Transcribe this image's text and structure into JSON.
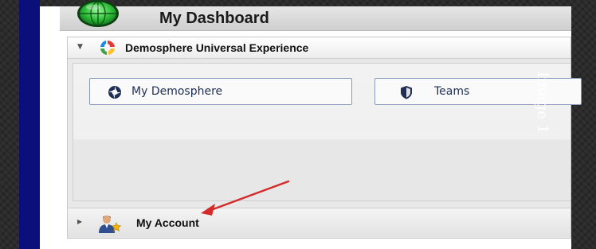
{
  "dashboard": {
    "title": "My Dashboard",
    "logo_icon": "green-globe-icon"
  },
  "section": {
    "title": "Demosphere Universal Experience",
    "toggle_icon": "caret-down-icon",
    "icon": "demosphere-logo-icon",
    "tiles": [
      {
        "label": "My Demosphere",
        "icon": "demosphere-logo-icon"
      },
      {
        "label": "Teams",
        "icon": "shield-icon"
      }
    ]
  },
  "account": {
    "label": "My Account",
    "toggle_icon": "caret-right-icon",
    "icon": "user-star-icon"
  },
  "annotation": {
    "caption": "Image 1",
    "arrow_color": "#d42a2a"
  },
  "colors": {
    "sidebar": "#0a0f7a",
    "tile_border": "#8a9ab8",
    "tile_text": "#1f2f55"
  }
}
